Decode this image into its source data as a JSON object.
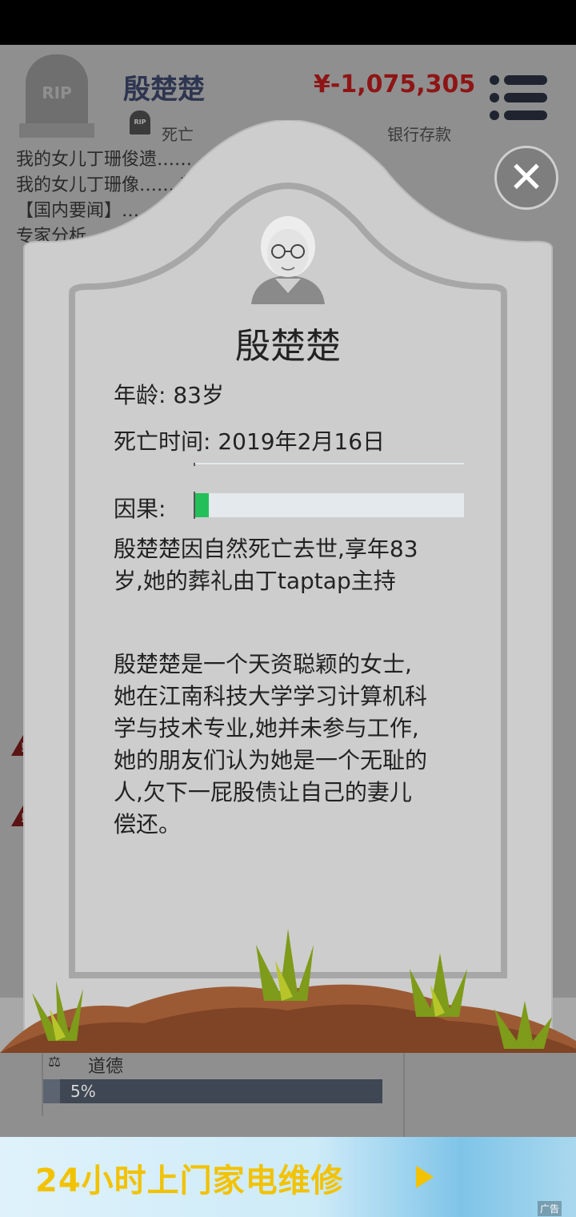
{
  "header": {
    "name": "殷楚楚",
    "status": "死亡",
    "money": "¥-1,075,305",
    "money_label": "银行存款",
    "rip_text": "RIP"
  },
  "log": {
    "lines": [
      "我的女儿丁珊俊遗……",
      "我的女儿丁珊像……                     新工作",
      "【国内要闻】……                           两度升职,",
      "专家分析……"
    ]
  },
  "moral": {
    "label": "道德",
    "percent_text": "5%",
    "value": 0.05
  },
  "tombstone": {
    "name": "殷楚楚",
    "age_label": "年龄:",
    "age_value": "83岁",
    "death_label": "死亡时间:",
    "death_value": "2019年2月16日",
    "karma_label": "因果:",
    "karma_value": 0.05,
    "hidden_stat_value": 0.0,
    "paragraph1": "殷楚楚因自然死亡去世,享年83岁,她的葬礼由丁taptap主持",
    "paragraph2": "殷楚楚是一个天资聪颖的女士,她在江南科技大学学习计算机科学与技术专业,她并未参与工作,她的朋友们认为她是一个无耻的人,欠下一屁股债让自己的妻儿偿还。"
  },
  "close_symbol": "✕",
  "ad": {
    "text": "24小时上门家电维修",
    "tag": "广告"
  },
  "colors": {
    "stone": "#cdcdcd",
    "stone_border": "#a7a7a7",
    "karma_fill": "#23c05a",
    "bar_bg": "#e3e9ed",
    "money": "#8e1515",
    "ad_text": "#f2c200"
  },
  "icons": [
    "rip-tombstone-icon",
    "menu-icon",
    "close-icon",
    "elderly-avatar-icon",
    "scale-icon",
    "warning-icon",
    "grass-icon",
    "dirt-mound-icon",
    "play-arrow-icon"
  ]
}
